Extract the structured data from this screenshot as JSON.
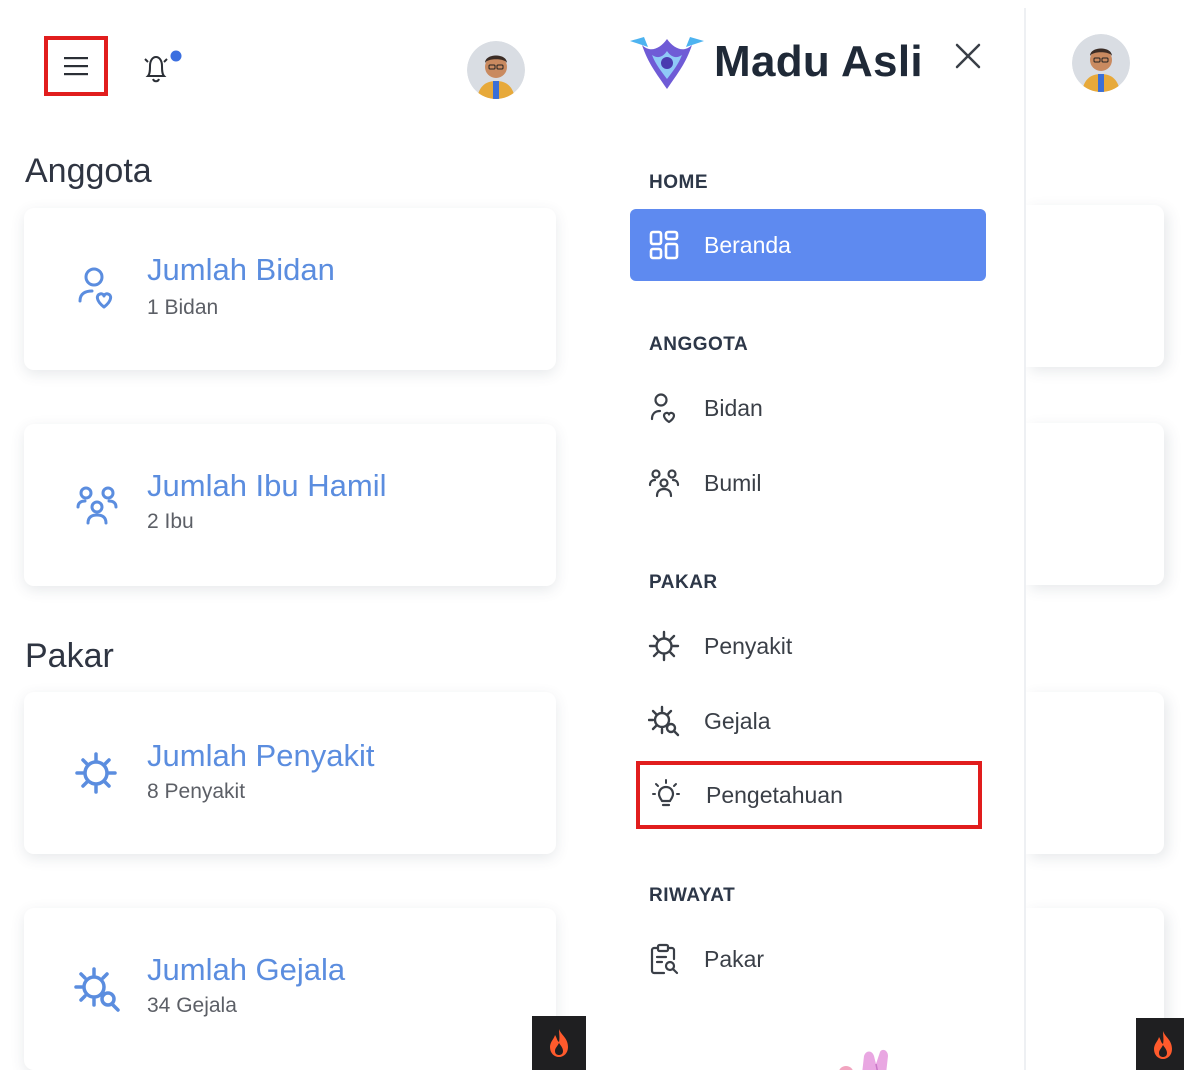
{
  "left": {
    "sections": [
      {
        "title": "Anggota"
      },
      {
        "title": "Pakar"
      }
    ],
    "cards": [
      {
        "title": "Jumlah Bidan",
        "subtitle": "1 Bidan",
        "icon": "user-heart-icon"
      },
      {
        "title": "Jumlah Ibu Hamil",
        "subtitle": "2 Ibu",
        "icon": "users-group-icon"
      },
      {
        "title": "Jumlah Penyakit",
        "subtitle": "8 Penyakit",
        "icon": "virus-icon"
      },
      {
        "title": "Jumlah Gejala",
        "subtitle": "34 Gejala",
        "icon": "virus-search-icon"
      }
    ]
  },
  "drawer": {
    "brand": "Madu Asli",
    "groups": [
      {
        "heading": "HOME",
        "items": [
          {
            "label": "Beranda",
            "icon": "dashboard-icon",
            "active": true
          }
        ]
      },
      {
        "heading": "ANGGOTA",
        "items": [
          {
            "label": "Bidan",
            "icon": "user-heart-icon"
          },
          {
            "label": "Bumil",
            "icon": "users-group-icon"
          }
        ]
      },
      {
        "heading": "PAKAR",
        "items": [
          {
            "label": "Penyakit",
            "icon": "virus-icon"
          },
          {
            "label": "Gejala",
            "icon": "virus-search-icon"
          },
          {
            "label": "Pengetahuan",
            "icon": "lightbulb-icon",
            "highlighted": true
          }
        ]
      },
      {
        "heading": "RIWAYAT",
        "items": [
          {
            "label": "Pakar",
            "icon": "clipboard-search-icon"
          }
        ]
      }
    ]
  },
  "colors": {
    "accent": "#5e8af0",
    "card_title": "#5b8ddf",
    "highlight_box": "#e11d1d",
    "notification_dot": "#3b6fe0"
  }
}
